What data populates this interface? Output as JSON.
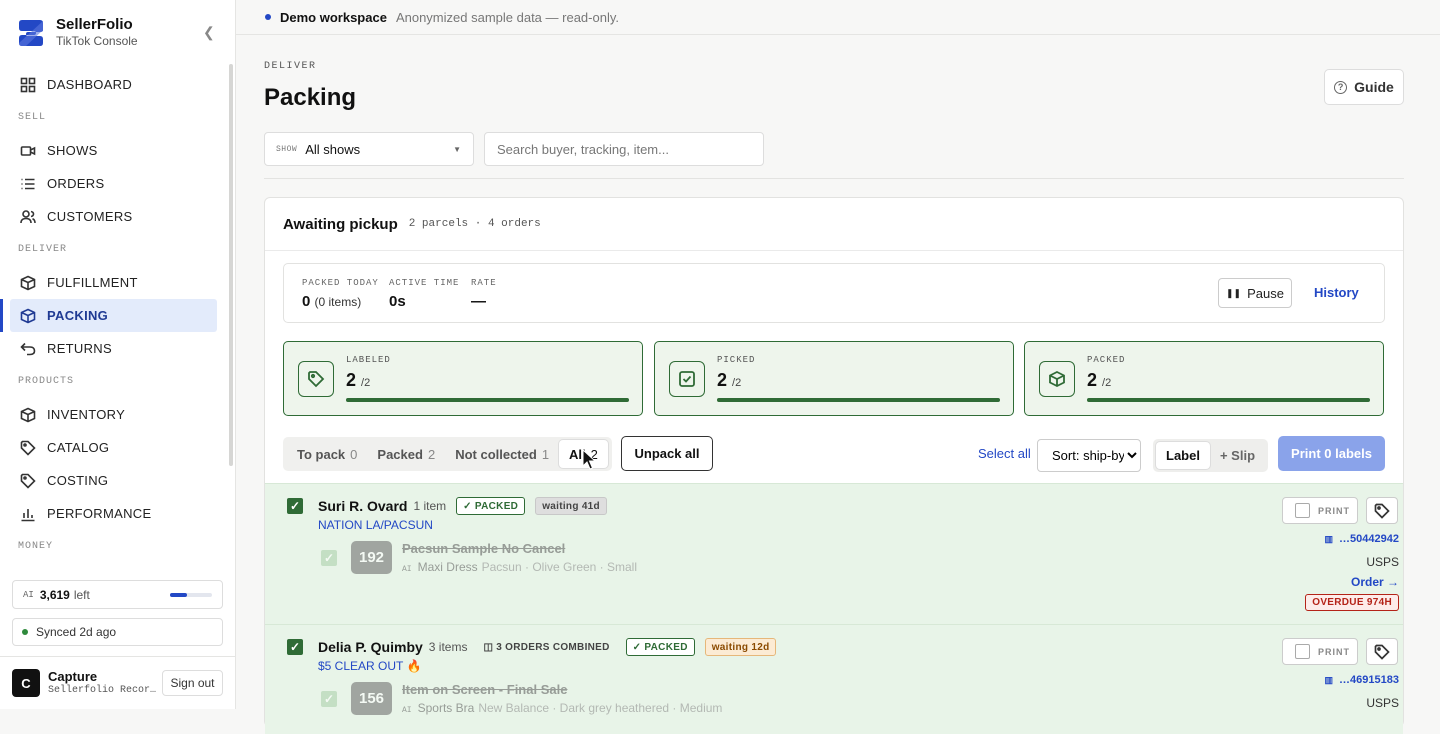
{
  "app": {
    "name": "SellerFolio",
    "subtitle": "TikTok Console"
  },
  "sidebar": {
    "items": [
      {
        "label": "DASHBOARD"
      },
      {
        "section": "SELL"
      },
      {
        "label": "SHOWS"
      },
      {
        "label": "ORDERS"
      },
      {
        "label": "CUSTOMERS"
      },
      {
        "section": "DELIVER"
      },
      {
        "label": "FULFILLMENT"
      },
      {
        "label": "PACKING"
      },
      {
        "label": "RETURNS"
      },
      {
        "section": "PRODUCTS"
      },
      {
        "label": "INVENTORY"
      },
      {
        "label": "CATALOG"
      },
      {
        "label": "COSTING"
      },
      {
        "label": "PERFORMANCE"
      },
      {
        "section": "MONEY"
      }
    ],
    "ai_credits": {
      "tag": "AI",
      "value": "3,619",
      "suffix": "left",
      "fraction": 0.4
    },
    "sync_status": "Synced 2d ago",
    "user": {
      "initial": "C",
      "name": "Capture",
      "sub": "Sellerfolio Recor…",
      "signout": "Sign out"
    }
  },
  "banner": {
    "title": "Demo workspace",
    "subtitle": "Anonymized sample data — read-only."
  },
  "page": {
    "eyebrow": "DELIVER",
    "title": "Packing",
    "guide": "Guide"
  },
  "filters": {
    "show_tag": "SHOW",
    "show_value": "All shows",
    "search_placeholder": "Search buyer, tracking, item..."
  },
  "card": {
    "title": "Awaiting pickup",
    "meta": "2 parcels · 4 orders",
    "stats": {
      "packed_today_label": "PACKED TODAY",
      "packed_today_value": "0",
      "packed_today_items": "(0 items)",
      "active_time_label": "ACTIVE TIME",
      "active_time_value": "0s",
      "rate_label": "RATE",
      "rate_value": "—",
      "pause": "Pause",
      "history": "History"
    },
    "progress": [
      {
        "label": "LABELED",
        "value": "2",
        "total": "/2",
        "fraction": 1.0
      },
      {
        "label": "PICKED",
        "value": "2",
        "total": "/2",
        "fraction": 1.0
      },
      {
        "label": "PACKED",
        "value": "2",
        "total": "/2",
        "fraction": 1.0
      }
    ],
    "tabs": [
      {
        "label": "To pack",
        "count": "0"
      },
      {
        "label": "Packed",
        "count": "2"
      },
      {
        "label": "Not collected",
        "count": "1"
      },
      {
        "label": "All",
        "count": "2"
      }
    ],
    "unpack_all": "Unpack all",
    "select_all": "Select all",
    "sort": "Sort: ship-by",
    "mode_label": "Label",
    "mode_slip": "+ Slip",
    "print_labels": "Print 0 labels",
    "print_tag": "PRINT"
  },
  "parcels": [
    {
      "buyer": "Suri R. Ovard",
      "items": "1 item",
      "status": "✓ PACKED",
      "waiting": "waiting 41d",
      "shop": "NATION LA/PACSUN",
      "item_num": "192",
      "item_name": "Pacsun Sample No Cancel",
      "ai_tag": "AI",
      "item_title": "Maxi Dress",
      "item_desc": "Pacsun · Olive Green · Small",
      "tracking": "…50442942",
      "carrier": "USPS",
      "order_link": "Order →",
      "overdue": "OVERDUE 974H"
    },
    {
      "buyer": "Delia P. Quimby",
      "items": "3 items",
      "combined": "3 ORDERS COMBINED",
      "status": "✓ PACKED",
      "waiting": "waiting 12d",
      "shop": "$5 CLEAR OUT 🔥",
      "item_num": "156",
      "item_name": "Item on Screen - Final Sale",
      "ai_tag": "AI",
      "item_title": "Sports Bra",
      "item_desc": "New Balance · Dark grey heathered · Medium",
      "tracking": "…46915183",
      "carrier": "USPS"
    }
  ]
}
